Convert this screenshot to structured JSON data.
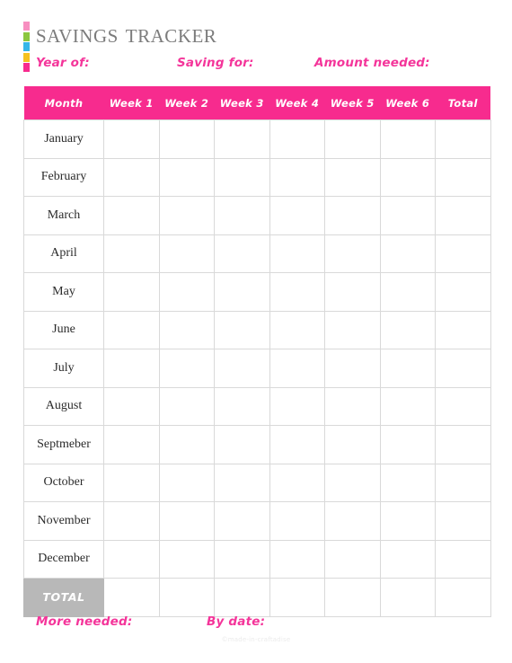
{
  "document": {
    "title": "Savings Tracker",
    "accent_color": "#f72b8e",
    "title_color": "#7c7c7c",
    "total_row_color": "#b8b8b8",
    "grid_color": "#d9d9d9"
  },
  "stripe": {
    "segments": [
      {
        "name": "stripe-pink-top",
        "color": "#f78fc0"
      },
      {
        "name": "stripe-green",
        "color": "#8cc63f"
      },
      {
        "name": "stripe-blue",
        "color": "#35b6e8"
      },
      {
        "name": "stripe-orange",
        "color": "#f5c220"
      },
      {
        "name": "stripe-pink-bottom",
        "color": "#f72b8e"
      }
    ]
  },
  "fields": {
    "year_of": "Year of:",
    "saving_for": "Saving for:",
    "amount_needed": "Amount needed:"
  },
  "table": {
    "columns": [
      "Month",
      "Week 1",
      "Week 2",
      "Week 3",
      "Week 4",
      "Week 5",
      "Week 6",
      "Total"
    ],
    "rows": [
      {
        "month": "January",
        "values": [
          "",
          "",
          "",
          "",
          "",
          "",
          ""
        ]
      },
      {
        "month": "February",
        "values": [
          "",
          "",
          "",
          "",
          "",
          "",
          ""
        ]
      },
      {
        "month": "March",
        "values": [
          "",
          "",
          "",
          "",
          "",
          "",
          ""
        ]
      },
      {
        "month": "April",
        "values": [
          "",
          "",
          "",
          "",
          "",
          "",
          ""
        ]
      },
      {
        "month": "May",
        "values": [
          "",
          "",
          "",
          "",
          "",
          "",
          ""
        ]
      },
      {
        "month": "June",
        "values": [
          "",
          "",
          "",
          "",
          "",
          "",
          ""
        ]
      },
      {
        "month": "July",
        "values": [
          "",
          "",
          "",
          "",
          "",
          "",
          ""
        ]
      },
      {
        "month": "August",
        "values": [
          "",
          "",
          "",
          "",
          "",
          "",
          ""
        ]
      },
      {
        "month": "Septmeber",
        "values": [
          "",
          "",
          "",
          "",
          "",
          "",
          ""
        ]
      },
      {
        "month": "October",
        "values": [
          "",
          "",
          "",
          "",
          "",
          "",
          ""
        ]
      },
      {
        "month": "November",
        "values": [
          "",
          "",
          "",
          "",
          "",
          "",
          ""
        ]
      },
      {
        "month": "December",
        "values": [
          "",
          "",
          "",
          "",
          "",
          "",
          ""
        ]
      }
    ],
    "total_row": {
      "label": "TOTAL",
      "values": [
        "",
        "",
        "",
        "",
        "",
        "",
        ""
      ]
    }
  },
  "footer": {
    "more_needed": "More needed:",
    "by_date": "By date:",
    "watermark": "©made-in-craftadise"
  }
}
